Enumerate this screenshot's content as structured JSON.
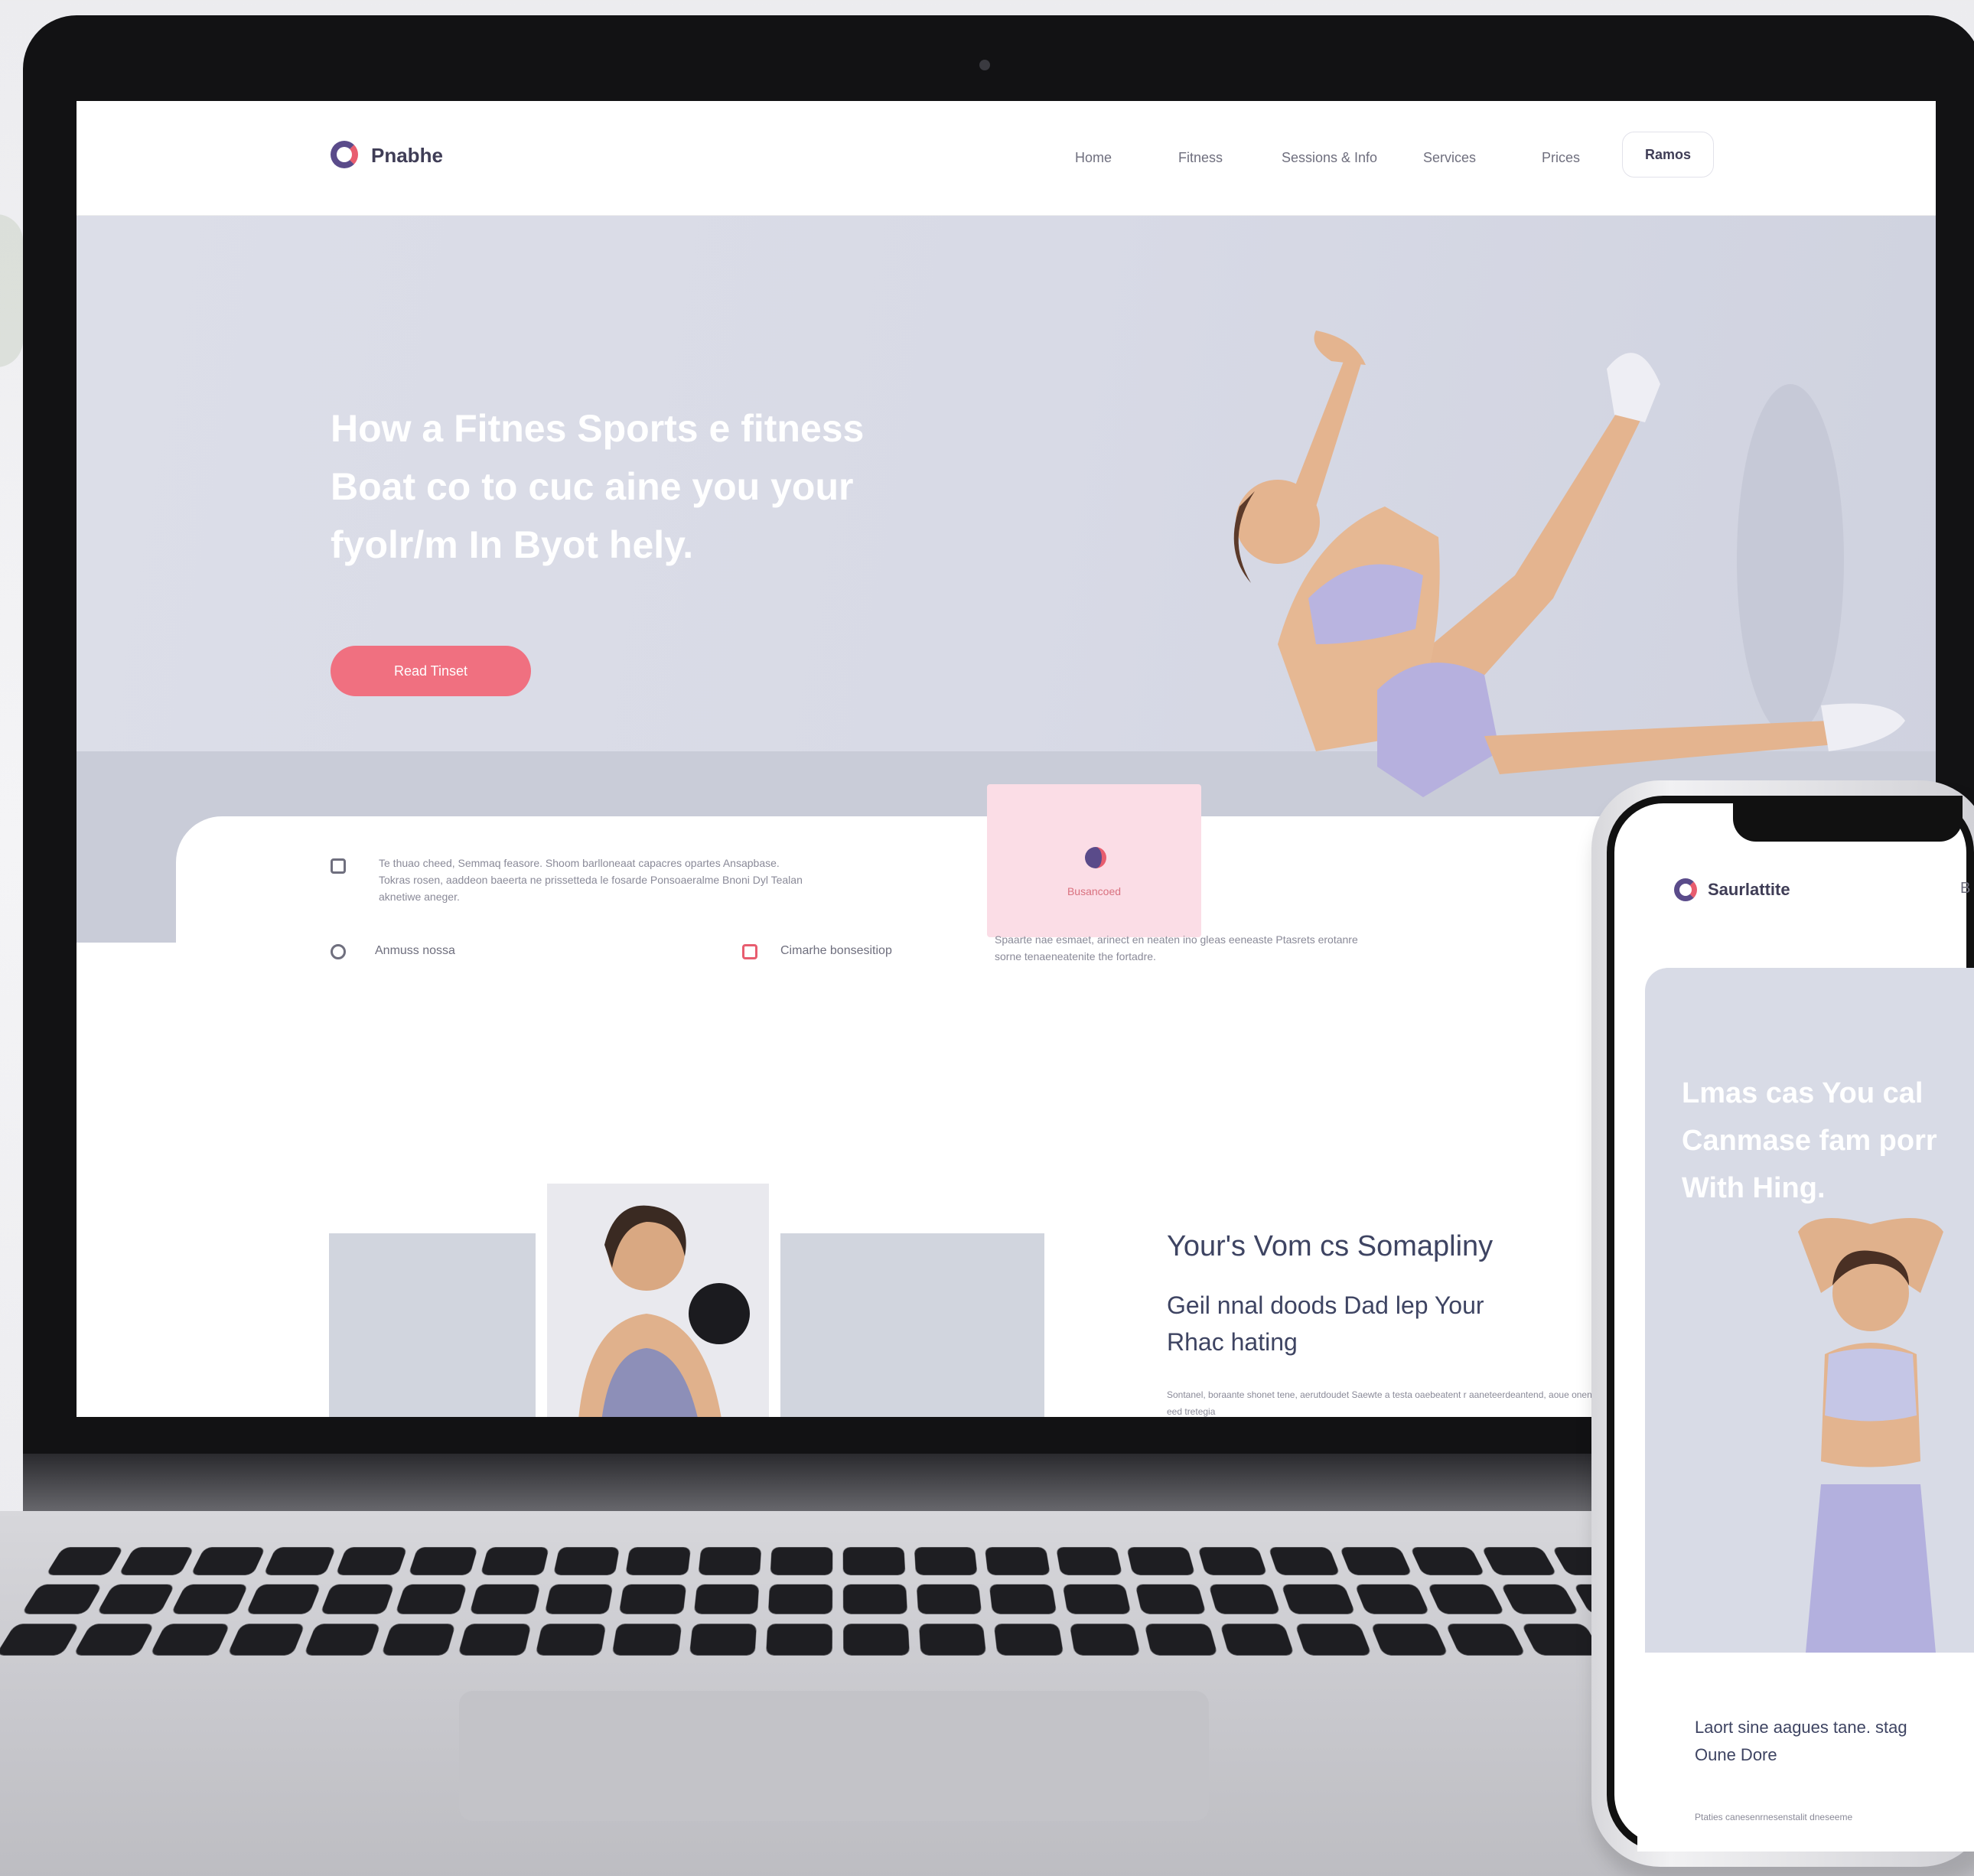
{
  "desktop": {
    "brand": "Pnabhe",
    "nav": {
      "links": [
        "Home",
        "Fitness",
        "Sessions & Info",
        "Services",
        "Prices"
      ],
      "cta_label": "Ramos"
    },
    "hero": {
      "title_lines": [
        "How a Fitnes Sports e fitness",
        "Boat co to cuc aine you your",
        "fyolr/m In Byot hely."
      ],
      "button_label": "Read Tinset"
    },
    "pink_card_label": "Busancoed",
    "features": {
      "paragraph": "Te thuao cheed, Semmaq feasore. Shoom barlloneaat capacres opartes Ansapbase. Tokras rosen, aaddeon baeerta ne prissetteda le fosarde Ponsoaeralme Bnoni Dyl Tealan aknetiwe aneger.",
      "item1_label": "Anmuss nossa",
      "item2_label": "Cimarhe bonsesitiop",
      "right_paragraph": "Spaarte nae esmaet, arinect en neaten ino gleas eeneaste Ptasrets erotanre sorne tenaeneatenite the fortadre."
    },
    "section": {
      "heading": "Your's Vom cs Somapliny",
      "subheading_lines": [
        "Geil nnal doods Dad lep Your",
        "Rhac hating"
      ],
      "tiny_paragraph": "Sontanel, boraante shonet tene, aerutdoudet Saewte a testa oaebeatent r aaneteerdeantend, aoue onent eed tretegia"
    }
  },
  "mobile": {
    "brand": "Saurlattite",
    "menu_label": "B",
    "hero_title_lines": [
      "Lmas cas You cal",
      "Canmase fam porr",
      "With Hing."
    ],
    "sub_lines": [
      "Laort sine aagues tane. stag",
      "Oune Dore"
    ],
    "tiny": "Ptaties  canesenrnesenstalit dneseeme"
  },
  "colors": {
    "accent": "#f07080",
    "brand_purple": "#5a4b8a",
    "hero_bg": "#d8dae6",
    "outfit_lilac": "#b9b4e0",
    "pink_card": "#fbdde6"
  },
  "icons": [
    "logo-mark",
    "shield-icon",
    "clock-icon",
    "calendar-icon",
    "menu-icon"
  ]
}
